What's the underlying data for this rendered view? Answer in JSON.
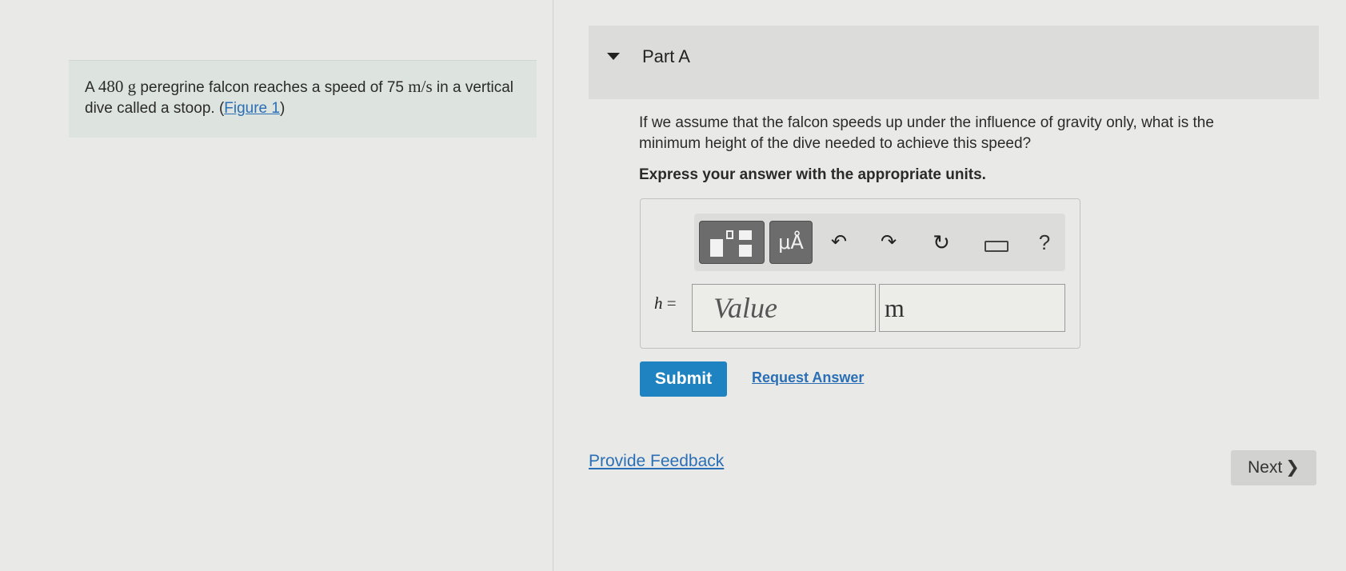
{
  "problem": {
    "text_before_mass": "A ",
    "mass_value": "480 g",
    "text_after_mass": " peregrine falcon reaches a speed of 75 ",
    "speed_unit": "m/s",
    "text_after_speed": " in a vertical dive called a stoop. (",
    "figure_link": "Figure 1",
    "text_close": ")"
  },
  "part": {
    "title": "Part A",
    "question": "If we assume that the falcon speeds up under the influence of gravity only, what is the minimum height of the dive needed to achieve this speed?",
    "instruction": "Express your answer with the appropriate units."
  },
  "toolbar": {
    "units_label": "μÅ",
    "undo_glyph": "↶",
    "redo_glyph": "↷",
    "reset_glyph": "↻",
    "help_label": "?"
  },
  "answer": {
    "variable": "h",
    "equals": " =",
    "value_placeholder": "Value",
    "unit_value": "m"
  },
  "actions": {
    "submit_label": "Submit",
    "request_answer_label": "Request Answer",
    "feedback_label": "Provide Feedback",
    "next_label": "Next",
    "next_chevron": "❯"
  },
  "colors": {
    "accent": "#1e83c0",
    "link": "#2a6fb5",
    "problem_bg": "#dde3df"
  }
}
